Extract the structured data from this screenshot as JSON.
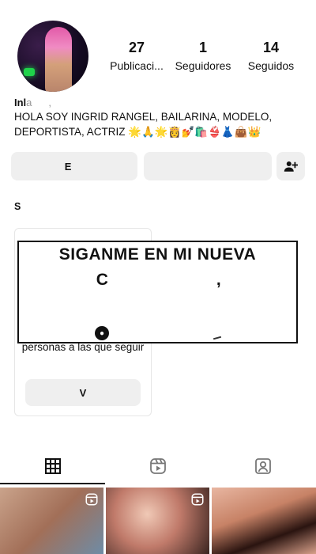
{
  "profile": {
    "stats": [
      {
        "value": "27",
        "label": "Publicaci..."
      },
      {
        "value": "1",
        "label": "Seguidores"
      },
      {
        "value": "14",
        "label": "Seguidos"
      }
    ],
    "name_visible": "Inl",
    "name_obscured": "a      ,   ",
    "bio": "HOLA SOY INGRID RANGEL, BAILARINA, MODELO, DEPORTISTA, ACTRIZ 🌟🙏🌟👸💅🛍️👙👗👜👑"
  },
  "buttons": {
    "edit_visible": "E",
    "edit_obscured": "   ",
    "share_obscured": "     "
  },
  "discover": {
    "label_visible": "S",
    "label_obscured": "                           ",
    "see_all_obscured": "     "
  },
  "suggestion_card": {
    "text": "personas a las que seguir",
    "button_visible": "V"
  },
  "overlay": {
    "line1": "SIGANME EN MI NUEVA",
    "line2_visible": "C",
    "line2_obscured": "                             ",
    "line2_end": ","
  },
  "tabs": [
    "grid-icon",
    "reels-icon",
    "tagged-icon"
  ],
  "colors": {
    "accent": "#2a6fdb",
    "button_bg": "#efefef",
    "text": "#111111"
  }
}
